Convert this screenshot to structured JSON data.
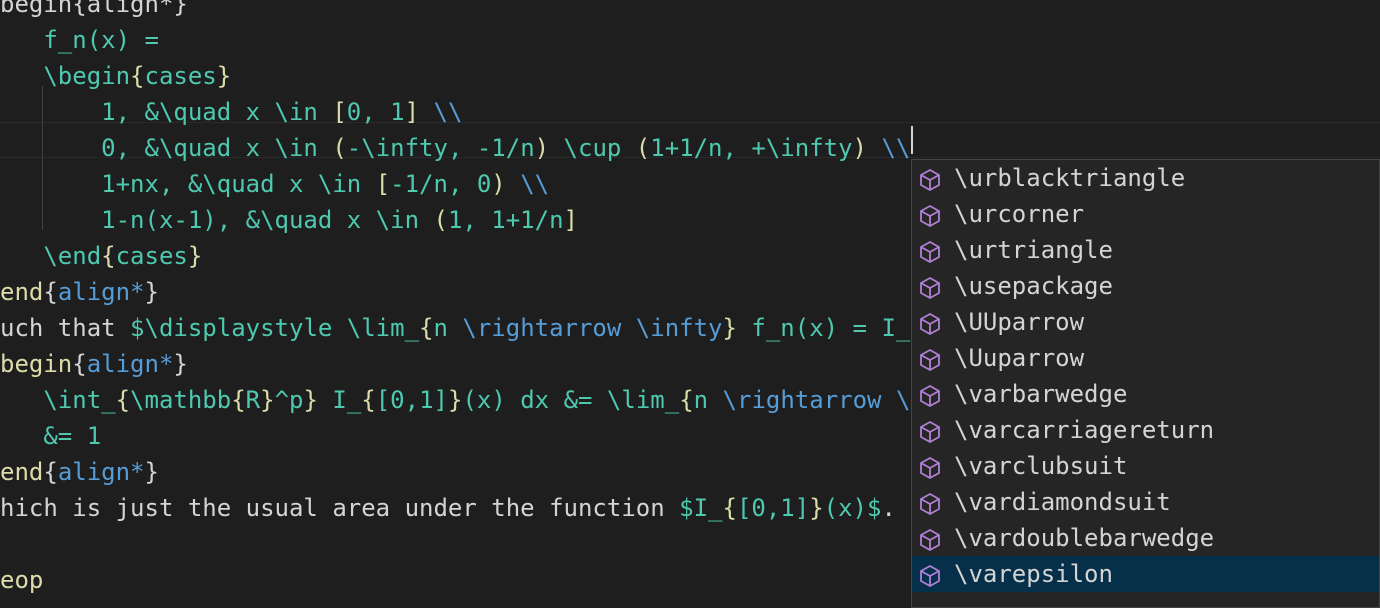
{
  "editor": {
    "lines": [
      {
        "segments": [
          {
            "t": "begin{align*}",
            "c": "t-default"
          }
        ]
      },
      {
        "segments": [
          {
            "t": "   f_n(x) =",
            "c": "t-math"
          }
        ]
      },
      {
        "segments": [
          {
            "t": "   \\begin",
            "c": "t-math"
          },
          {
            "t": "{",
            "c": "t-key"
          },
          {
            "t": "cases",
            "c": "t-math"
          },
          {
            "t": "}",
            "c": "t-key"
          }
        ]
      },
      {
        "segments": [
          {
            "t": "       1, &\\quad x \\in ",
            "c": "t-math"
          },
          {
            "t": "[",
            "c": "t-key"
          },
          {
            "t": "0, 1",
            "c": "t-math"
          },
          {
            "t": "]",
            "c": "t-key"
          },
          {
            "t": " \\\\",
            "c": "t-cmd"
          }
        ]
      },
      {
        "segments": [
          {
            "t": "       0, &\\quad x \\in ",
            "c": "t-math"
          },
          {
            "t": "(",
            "c": "t-key"
          },
          {
            "t": "-\\infty, -1/n",
            "c": "t-math"
          },
          {
            "t": ")",
            "c": "t-key"
          },
          {
            "t": " \\cup ",
            "c": "t-math"
          },
          {
            "t": "(",
            "c": "t-key"
          },
          {
            "t": "1+1/n, +\\infty",
            "c": "t-math"
          },
          {
            "t": ")",
            "c": "t-key"
          },
          {
            "t": " \\\\",
            "c": "t-cmd"
          }
        ]
      },
      {
        "segments": [
          {
            "t": "       1+nx, &\\quad x \\in ",
            "c": "t-math"
          },
          {
            "t": "[",
            "c": "t-key"
          },
          {
            "t": "-1/n, 0",
            "c": "t-math"
          },
          {
            "t": ")",
            "c": "t-key"
          },
          {
            "t": " \\\\",
            "c": "t-cmd"
          }
        ]
      },
      {
        "segments": [
          {
            "t": "       1-n(x-1), &\\quad x \\in ",
            "c": "t-math"
          },
          {
            "t": "(",
            "c": "t-key"
          },
          {
            "t": "1, 1+1/n",
            "c": "t-math"
          },
          {
            "t": "]",
            "c": "t-key"
          }
        ]
      },
      {
        "segments": [
          {
            "t": "   \\end",
            "c": "t-math"
          },
          {
            "t": "{",
            "c": "t-key"
          },
          {
            "t": "cases",
            "c": "t-math"
          },
          {
            "t": "}",
            "c": "t-key"
          }
        ]
      },
      {
        "segments": [
          {
            "t": "end",
            "c": "t-key"
          },
          {
            "t": "{",
            "c": "t-default"
          },
          {
            "t": "align*",
            "c": "t-cmd"
          },
          {
            "t": "}",
            "c": "t-default"
          }
        ]
      },
      {
        "segments": [
          {
            "t": "uch that ",
            "c": "t-default"
          },
          {
            "t": "$\\displaystyle \\lim_",
            "c": "t-math"
          },
          {
            "t": "{",
            "c": "t-key"
          },
          {
            "t": "n ",
            "c": "t-math"
          },
          {
            "t": "\\rightarrow",
            "c": "t-cmd"
          },
          {
            "t": " ",
            "c": "t-math"
          },
          {
            "t": "\\infty",
            "c": "t-cmd"
          },
          {
            "t": "}",
            "c": "t-key"
          },
          {
            "t": " f_n(x) = I_",
            "c": "t-math"
          }
        ]
      },
      {
        "segments": [
          {
            "t": "begin",
            "c": "t-key"
          },
          {
            "t": "{",
            "c": "t-default"
          },
          {
            "t": "align*",
            "c": "t-cmd"
          },
          {
            "t": "}",
            "c": "t-default"
          }
        ]
      },
      {
        "segments": [
          {
            "t": "   \\int_",
            "c": "t-math"
          },
          {
            "t": "{",
            "c": "t-key"
          },
          {
            "t": "\\mathbb",
            "c": "t-math"
          },
          {
            "t": "{",
            "c": "t-key"
          },
          {
            "t": "R",
            "c": "t-math"
          },
          {
            "t": "}",
            "c": "t-key"
          },
          {
            "t": "^p",
            "c": "t-math"
          },
          {
            "t": "}",
            "c": "t-key"
          },
          {
            "t": " I_",
            "c": "t-math"
          },
          {
            "t": "{",
            "c": "t-key"
          },
          {
            "t": "[0,1]",
            "c": "t-math"
          },
          {
            "t": "}",
            "c": "t-key"
          },
          {
            "t": "(x) dx &= \\lim_",
            "c": "t-math"
          },
          {
            "t": "{",
            "c": "t-key"
          },
          {
            "t": "n ",
            "c": "t-math"
          },
          {
            "t": "\\rightarrow",
            "c": "t-cmd"
          },
          {
            "t": " \\",
            "c": "t-cmd"
          }
        ]
      },
      {
        "segments": [
          {
            "t": "   &= 1",
            "c": "t-math"
          }
        ]
      },
      {
        "segments": [
          {
            "t": "end",
            "c": "t-key"
          },
          {
            "t": "{",
            "c": "t-default"
          },
          {
            "t": "align*",
            "c": "t-cmd"
          },
          {
            "t": "}",
            "c": "t-default"
          }
        ]
      },
      {
        "segments": [
          {
            "t": "hich is just the usual area under the function ",
            "c": "t-default"
          },
          {
            "t": "$I_",
            "c": "t-math"
          },
          {
            "t": "{",
            "c": "t-key"
          },
          {
            "t": "[0,1]",
            "c": "t-math"
          },
          {
            "t": "}",
            "c": "t-key"
          },
          {
            "t": "(x)$",
            "c": "t-math"
          },
          {
            "t": ".",
            "c": "t-default"
          }
        ]
      },
      {
        "segments": [
          {
            "t": "",
            "c": "t-default"
          }
        ]
      },
      {
        "segments": [
          {
            "t": "eop",
            "c": "t-key"
          }
        ]
      }
    ]
  },
  "suggestions": {
    "items": [
      {
        "label": "\\urblacktriangle"
      },
      {
        "label": "\\urcorner"
      },
      {
        "label": "\\urtriangle"
      },
      {
        "label": "\\usepackage"
      },
      {
        "label": "\\UUparrow"
      },
      {
        "label": "\\Uuparrow"
      },
      {
        "label": "\\varbarwedge"
      },
      {
        "label": "\\varcarriagereturn"
      },
      {
        "label": "\\varclubsuit"
      },
      {
        "label": "\\vardiamondsuit"
      },
      {
        "label": "\\vardoublebarwedge"
      },
      {
        "label": "\\varepsilon"
      }
    ],
    "selected_index": 11,
    "icon": "cube-icon",
    "icon_color": "#b180d7"
  }
}
